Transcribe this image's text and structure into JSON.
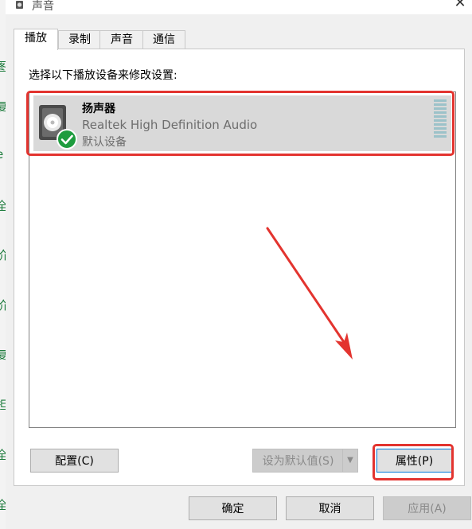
{
  "window": {
    "title": "声音"
  },
  "tabs": [
    {
      "label": "播放",
      "active": true
    },
    {
      "label": "录制",
      "active": false
    },
    {
      "label": "声音",
      "active": false
    },
    {
      "label": "通信",
      "active": false
    }
  ],
  "playback": {
    "prompt": "选择以下播放设备来修改设置:",
    "devices": [
      {
        "name": "扬声器",
        "driver": "Realtek High Definition Audio",
        "status": "默认设备",
        "selected": true
      }
    ]
  },
  "panel_buttons": {
    "configure": "配置(C)",
    "set_default": "设为默认值(S)",
    "properties": "属性(P)"
  },
  "dialog_buttons": {
    "ok": "确定",
    "cancel": "取消",
    "apply": "应用(A)"
  },
  "annotation": {
    "color": "#e3342f"
  },
  "background_glyphs": [
    "图",
    "复",
    "单",
    "e",
    "全",
    "价",
    "价",
    "复",
    "担",
    "全",
    "全"
  ]
}
